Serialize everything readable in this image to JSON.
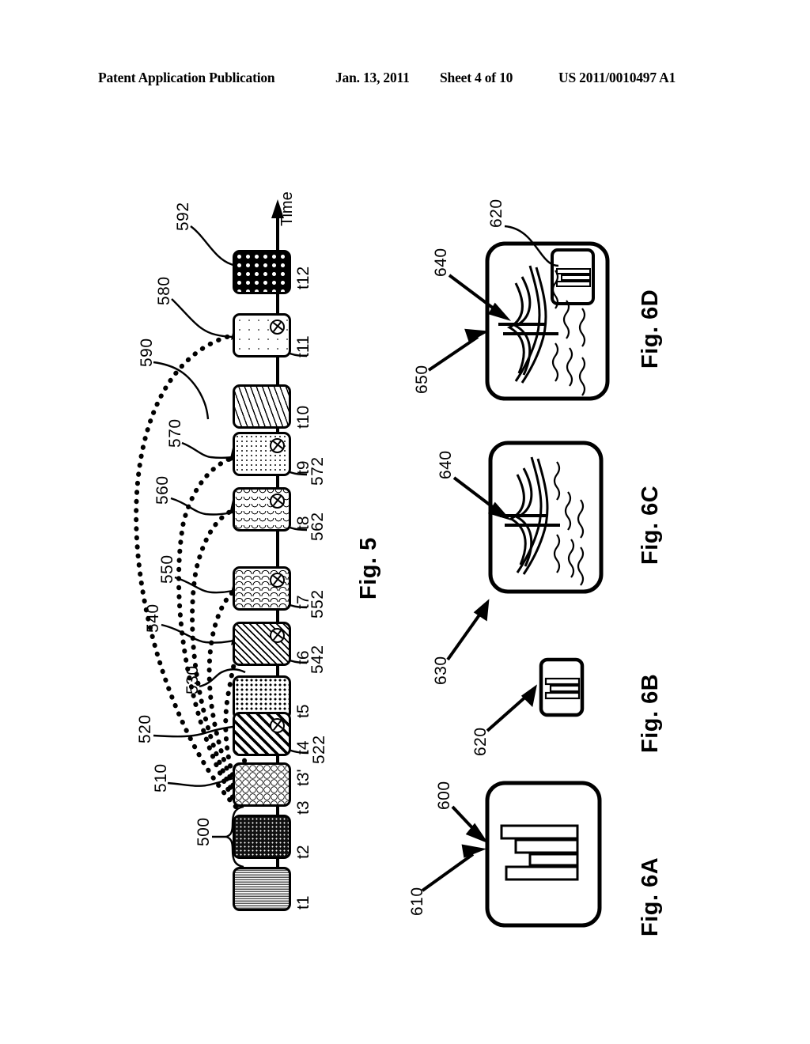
{
  "header": {
    "publication": "Patent Application Publication",
    "date": "Jan. 13, 2011",
    "sheet": "Sheet 4 of 10",
    "patent_number": "US 2011/0010497 A1"
  },
  "figures": {
    "fig5": {
      "label": "Fig. 5",
      "axis_label": "Time",
      "time_ticks": [
        "t1",
        "t2",
        "t3",
        "t3'",
        "t4",
        "t5",
        "t6",
        "t7",
        "t8",
        "t9",
        "t10",
        "t11",
        "t12"
      ],
      "reference_numbers": {
        "n500": "500",
        "n510": "510",
        "n520": "520",
        "n522": "522",
        "n530": "530",
        "n540": "540",
        "n542": "542",
        "n550": "550",
        "n552": "552",
        "n560": "560",
        "n562": "562",
        "n570": "570",
        "n572": "572",
        "n580": "580",
        "n590": "590",
        "n592": "592"
      },
      "tiles": [
        {
          "tick": "t1",
          "pattern": "horizontal-stripes",
          "badge": false
        },
        {
          "tick": "t2",
          "pattern": "dark-dot-grid",
          "badge": false
        },
        {
          "tick": "t3",
          "pattern": "bubble-circles",
          "badge": false
        },
        {
          "tick": "t4",
          "pattern": "bold-diagonal",
          "badge": true
        },
        {
          "tick": "t5",
          "pattern": "speckle",
          "badge": false
        },
        {
          "tick": "t6",
          "pattern": "fine-hatch",
          "badge": true
        },
        {
          "tick": "t7",
          "pattern": "scale-wave",
          "badge": true
        },
        {
          "tick": "t8",
          "pattern": "vee-wave",
          "badge": true
        },
        {
          "tick": "t9",
          "pattern": "fine-dot",
          "badge": true
        },
        {
          "tick": "t10",
          "pattern": "tick-hatch",
          "badge": false
        },
        {
          "tick": "t11",
          "pattern": "sparse-dot",
          "badge": true
        },
        {
          "tick": "t12",
          "pattern": "bold-dot-grid",
          "badge": false
        }
      ]
    },
    "fig6a": {
      "label": "Fig. 6A",
      "reference_numbers": {
        "n600": "600",
        "n610": "610"
      }
    },
    "fig6b": {
      "label": "Fig. 6B",
      "reference_numbers": {
        "n620": "620"
      }
    },
    "fig6c": {
      "label": "Fig. 6C",
      "reference_numbers": {
        "n630": "630",
        "n640": "640"
      }
    },
    "fig6d": {
      "label": "Fig. 6D",
      "reference_numbers": {
        "n620": "620",
        "n640": "640",
        "n650": "650"
      }
    }
  },
  "colors": {
    "ink": "#000000",
    "paper": "#ffffff"
  }
}
